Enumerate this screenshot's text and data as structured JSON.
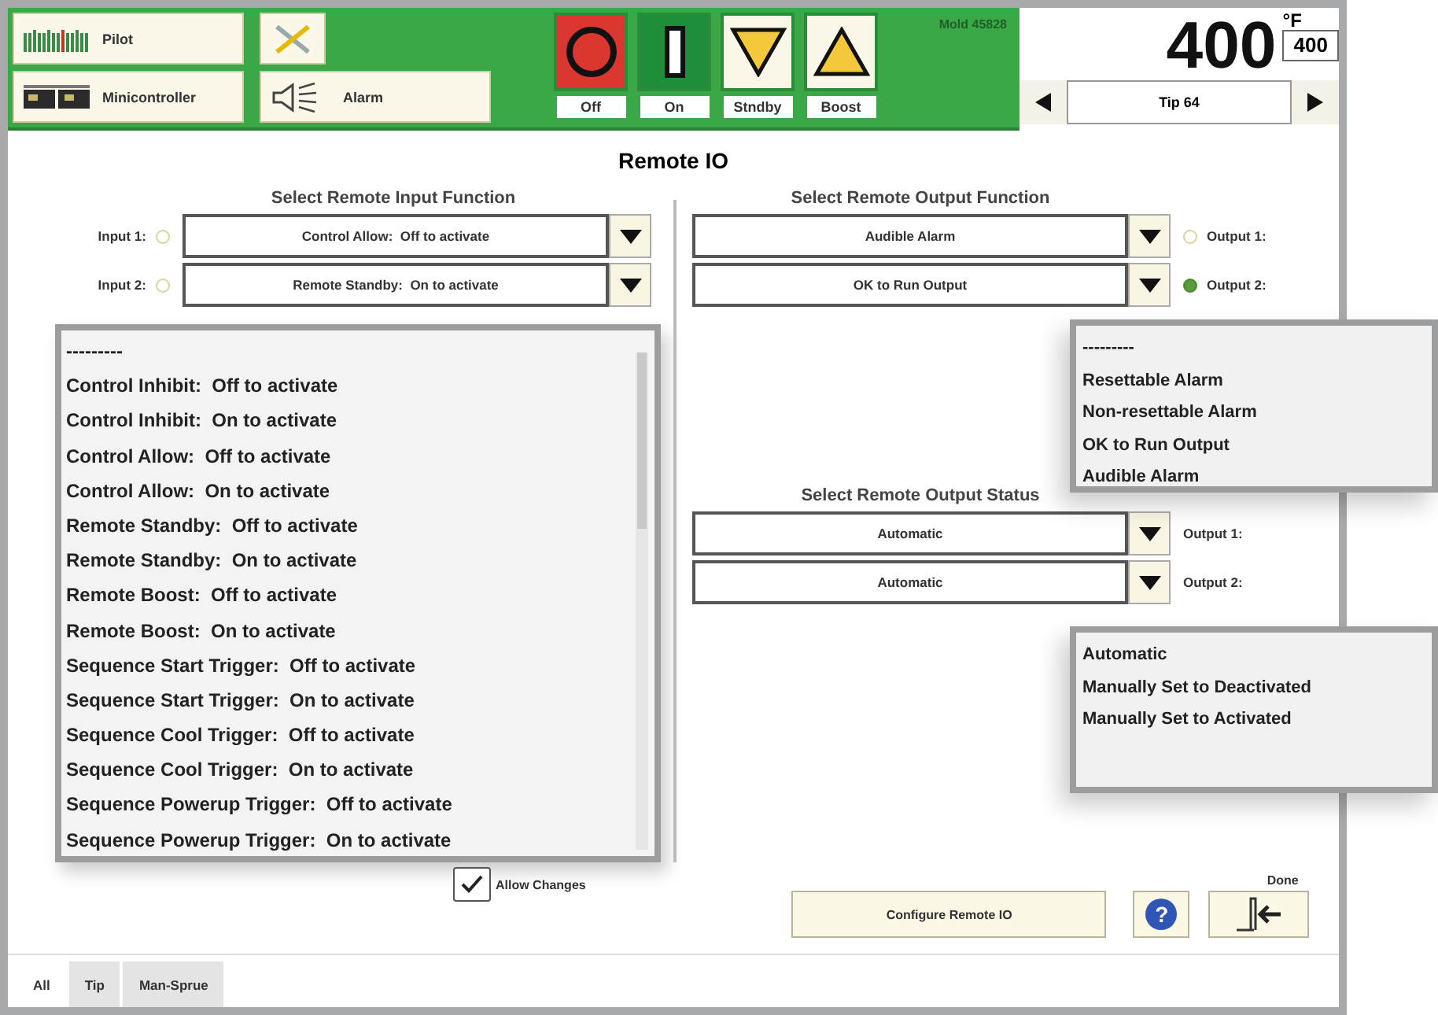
{
  "header": {
    "left_buttons": [
      {
        "kind": "pilot",
        "label": "Pilot"
      },
      {
        "kind": "minicontroller",
        "label": "Minicontroller"
      }
    ],
    "alarm_button": {
      "label": "Alarm"
    },
    "modes": [
      {
        "kind": "off",
        "label": "Off"
      },
      {
        "kind": "on",
        "label": "On"
      },
      {
        "kind": "standby",
        "label": "Stndby"
      },
      {
        "kind": "boost",
        "label": "Boost"
      }
    ],
    "model": "Mold 45828",
    "temperature": {
      "value": "400",
      "unit": "°F",
      "setpoint": "400"
    },
    "zone": {
      "label": "Tip 64"
    }
  },
  "title": "Remote IO",
  "input_function": {
    "heading": "Select Remote Input Function",
    "rows": [
      {
        "label": "Input 1:",
        "on": false,
        "value": "Control Allow:  Off to activate"
      },
      {
        "label": "Input 2:",
        "on": false,
        "value": "Remote Standby:  On to activate"
      }
    ],
    "list": [
      "---------",
      "Control Inhibit:  Off to activate",
      "Control Inhibit:  On to activate",
      "Control Allow:  Off to activate",
      "Control Allow:  On to activate",
      "Remote Standby:  Off to activate",
      "Remote Standby:  On to activate",
      "Remote Boost:  Off to activate",
      "Remote Boost:  On to activate",
      "Sequence Start Trigger:  Off to activate",
      "Sequence Start Trigger:  On to activate",
      "Sequence Cool Trigger:  Off to activate",
      "Sequence Cool Trigger:  On to activate",
      "Sequence Powerup Trigger:  Off to activate",
      "Sequence Powerup Trigger:  On to activate"
    ]
  },
  "output_function": {
    "heading": "Select Remote Output Function",
    "rows": [
      {
        "label": "Output 1:",
        "on": false,
        "value": "Audible Alarm"
      },
      {
        "label": "Output 2:",
        "on": true,
        "value": "OK to Run Output"
      }
    ],
    "list": [
      "---------",
      "Resettable Alarm",
      "Non-resettable Alarm",
      "OK to Run Output",
      "Audible Alarm"
    ]
  },
  "output_status": {
    "heading": "Select Remote Output Status",
    "rows": [
      {
        "label": "Output 1:",
        "value": "Automatic"
      },
      {
        "label": "Output 2:",
        "value": "Automatic"
      }
    ],
    "list": [
      "Automatic",
      "Manually Set to Deactivated",
      "Manually Set to Activated"
    ]
  },
  "allow_changes": {
    "label": "Allow Changes",
    "checked": true
  },
  "configure_button": "Configure Remote IO",
  "help_button": "?",
  "done_label": "Done",
  "tabs": [
    {
      "label": "All",
      "selected": true
    },
    {
      "label": "Tip",
      "selected": false
    },
    {
      "label": "Man-Sprue",
      "selected": false
    }
  ]
}
